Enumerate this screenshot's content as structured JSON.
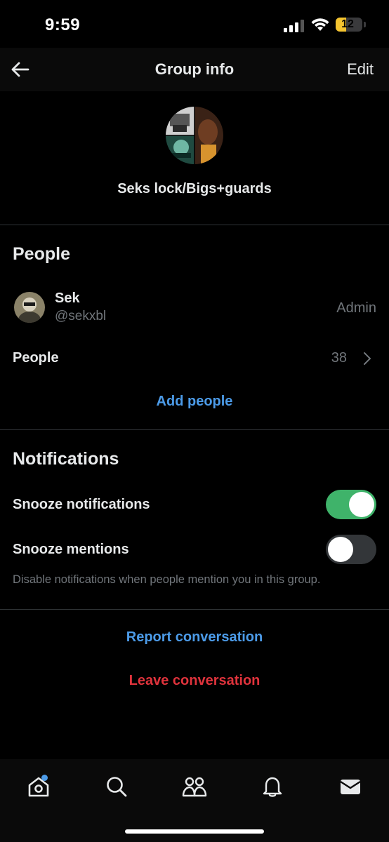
{
  "status_bar": {
    "time": "9:59",
    "battery_level": "12",
    "battery_percent": 12,
    "battery_color": "#f4c430"
  },
  "header": {
    "back_icon": "arrow-left-icon",
    "title": "Group info",
    "edit_label": "Edit"
  },
  "group": {
    "name": "Seks lock/Bigs+guards"
  },
  "people_section": {
    "title": "People",
    "member": {
      "name": "Sek",
      "handle": "@sekxbl",
      "role": "Admin"
    },
    "people_row_label": "People",
    "people_count": "38",
    "add_people_label": "Add people"
  },
  "notifications_section": {
    "title": "Notifications",
    "snooze_notifications_label": "Snooze notifications",
    "snooze_notifications_on": true,
    "snooze_mentions_label": "Snooze mentions",
    "snooze_mentions_on": false,
    "hint": "Disable notifications when people mention you in this group."
  },
  "actions": {
    "report_label": "Report conversation",
    "leave_label": "Leave conversation"
  },
  "tab_bar": {
    "tabs": [
      "home-icon",
      "search-icon",
      "communities-icon",
      "bell-icon",
      "mail-icon"
    ],
    "home_has_badge": true
  },
  "colors": {
    "accent_blue": "#4c9be8",
    "destructive_red": "#e0333c",
    "toggle_on": "#3fb36a",
    "background": "#000000"
  }
}
